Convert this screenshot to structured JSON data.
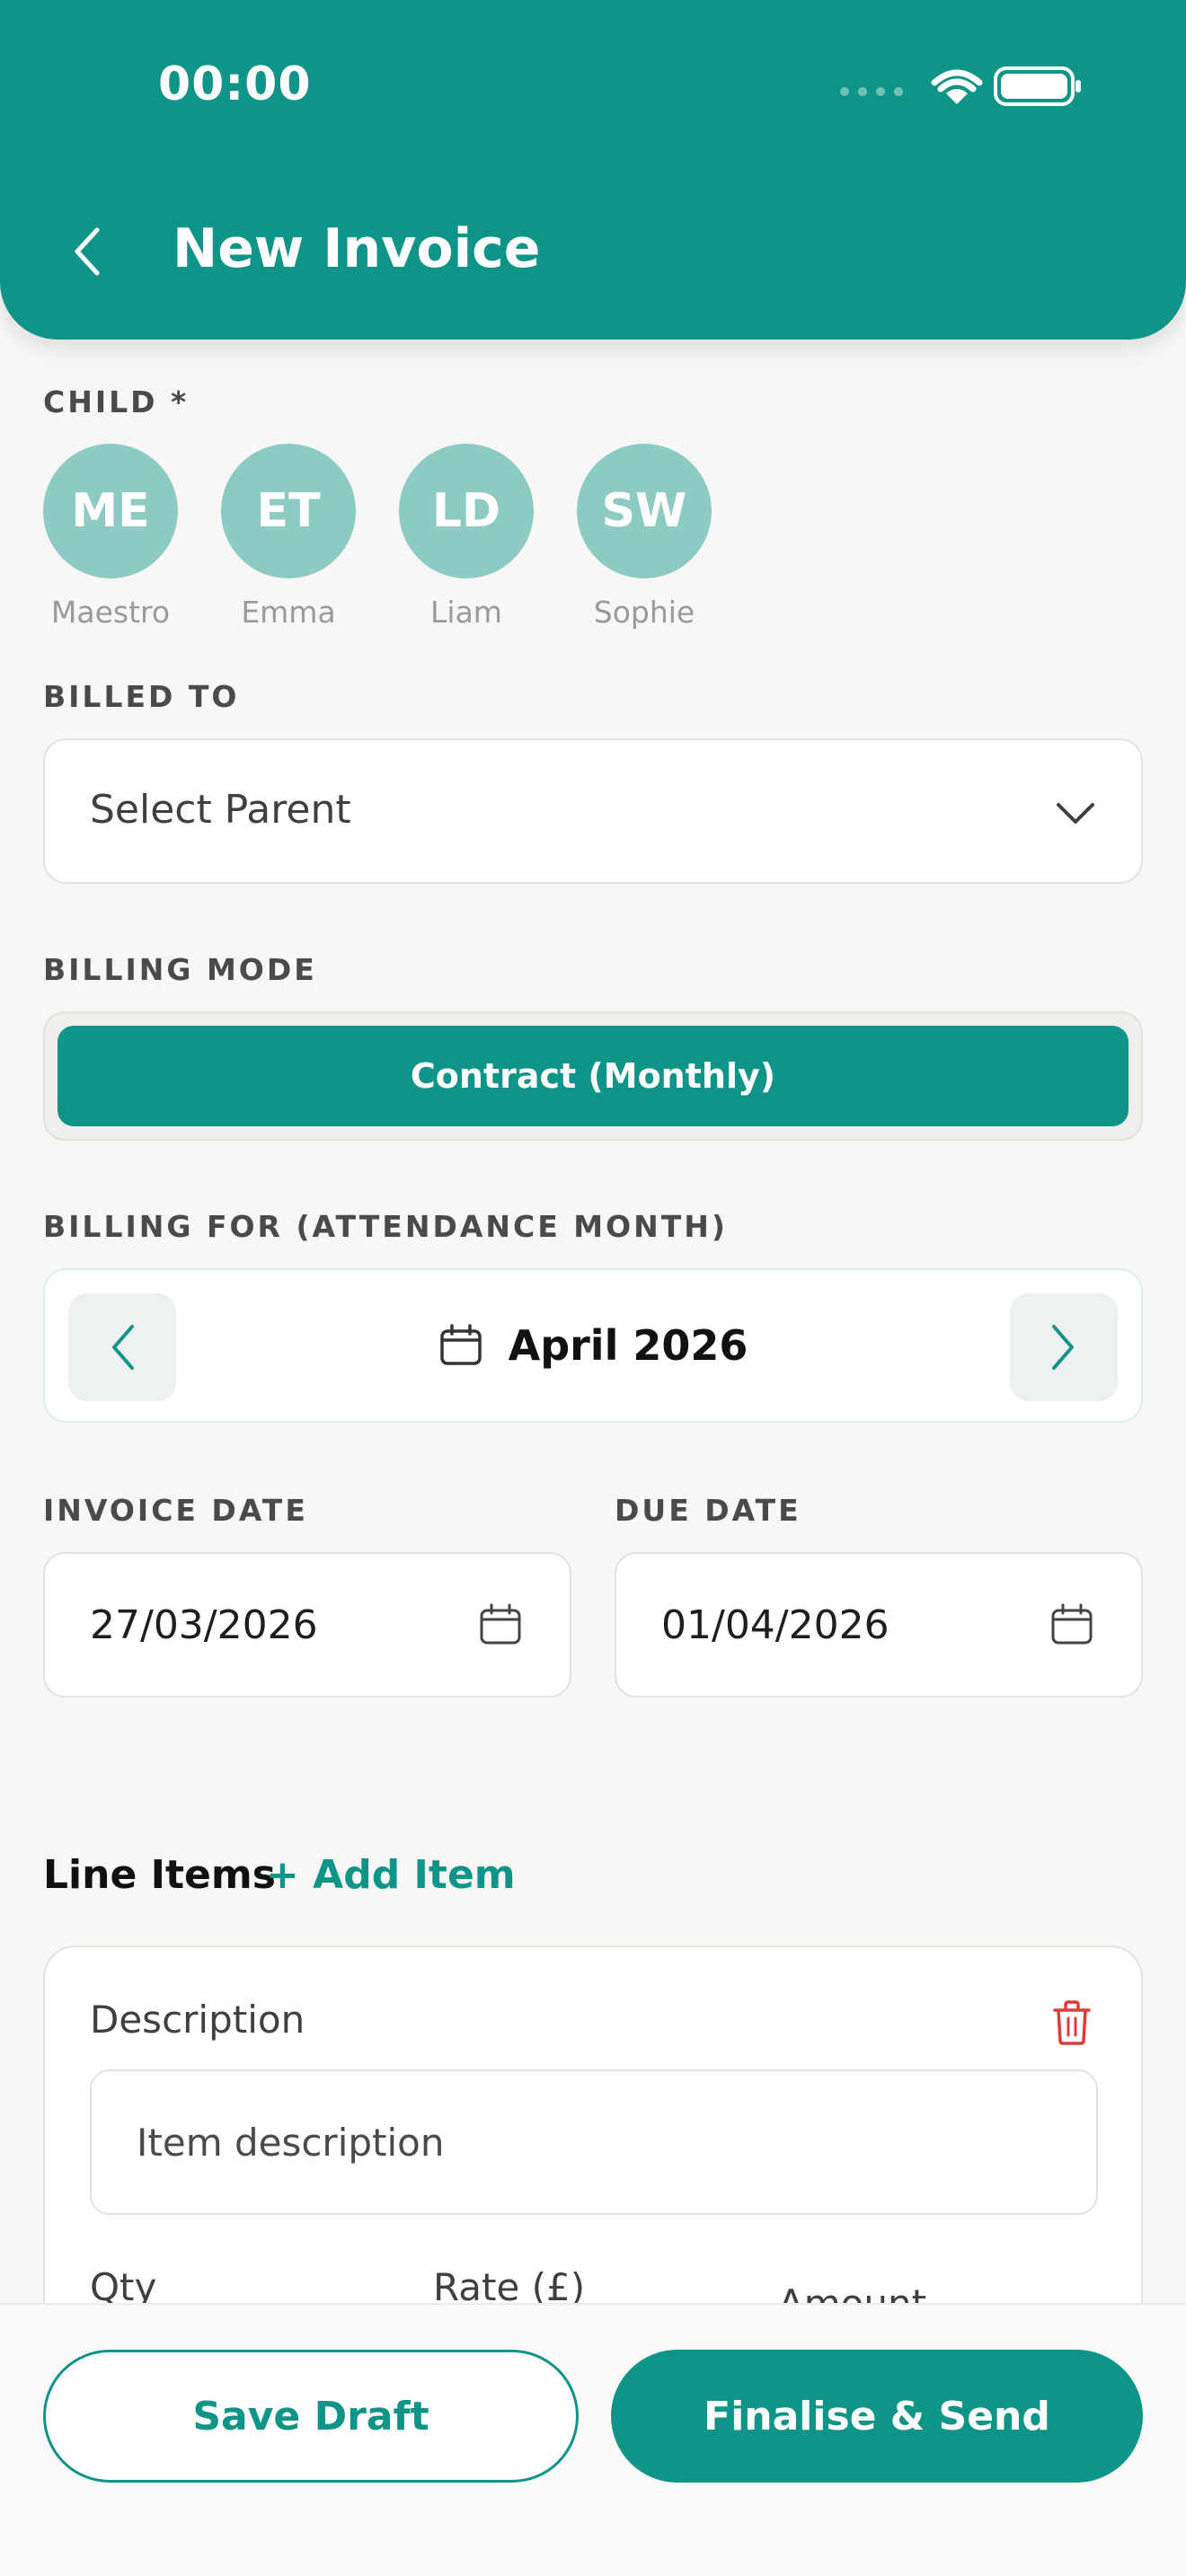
{
  "status_bar": {
    "time": "00:00"
  },
  "header": {
    "title": "New Invoice"
  },
  "child": {
    "label": "CHILD *",
    "children": [
      {
        "initials": "ME",
        "name": "Maestro"
      },
      {
        "initials": "ET",
        "name": "Emma"
      },
      {
        "initials": "LD",
        "name": "Liam"
      },
      {
        "initials": "SW",
        "name": "Sophie"
      }
    ]
  },
  "billed_to": {
    "label": "BILLED TO",
    "value": "Select Parent"
  },
  "billing_mode": {
    "label": "BILLING MODE",
    "selected": "Contract (Monthly)"
  },
  "billing_for": {
    "label": "BILLING FOR (ATTENDANCE MONTH)",
    "month": "April 2026"
  },
  "invoice_date": {
    "label": "INVOICE DATE",
    "value": "27/03/2026"
  },
  "due_date": {
    "label": "DUE DATE",
    "value": "01/04/2026"
  },
  "line_items": {
    "title": "Line Items",
    "add_label": "+ Add Item",
    "description_label": "Description",
    "description_placeholder": "Item description",
    "qty_label": "Qty",
    "rate_label": "Rate (£)",
    "amount_label": "Amount"
  },
  "actions": {
    "save_draft": "Save Draft",
    "finalise": "Finalise & Send"
  },
  "colors": {
    "primary": "#0f9488",
    "avatar": "#8ccac2",
    "danger": "#e03b3b"
  }
}
